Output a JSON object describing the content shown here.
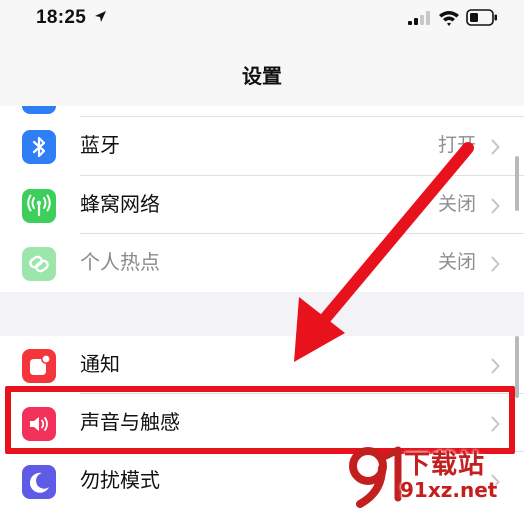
{
  "status_bar": {
    "time": "18:25"
  },
  "nav": {
    "title": "设置"
  },
  "settings": {
    "group1": [
      {
        "label": "蓝牙",
        "value": "打开",
        "icon": "bluetooth-icon",
        "icon_color": "#2f7ef6",
        "dimmed": false
      },
      {
        "label": "蜂窝网络",
        "value": "关闭",
        "icon": "cellular-antenna-icon",
        "icon_color": "#3ccf5c",
        "dimmed": false
      },
      {
        "label": "个人热点",
        "value": "关闭",
        "icon": "hotspot-link-icon",
        "icon_color": "#3ccf5c",
        "dimmed": true
      }
    ],
    "group2": [
      {
        "label": "通知",
        "value": "",
        "icon": "notification-icon",
        "icon_color": "#f4363a",
        "highlighted": false
      },
      {
        "label": "声音与触感",
        "value": "",
        "icon": "speaker-icon",
        "icon_color": "#f2325a",
        "highlighted": true
      },
      {
        "label": "勿扰模式",
        "value": "",
        "icon": "moon-icon",
        "icon_color": "#5e5ce6",
        "highlighted": false
      }
    ]
  },
  "annotation": {
    "color": "#e8121d",
    "arrow_points_to": "声音与触感"
  },
  "watermark": {
    "title": "下载站",
    "domain": "91xz.net"
  }
}
